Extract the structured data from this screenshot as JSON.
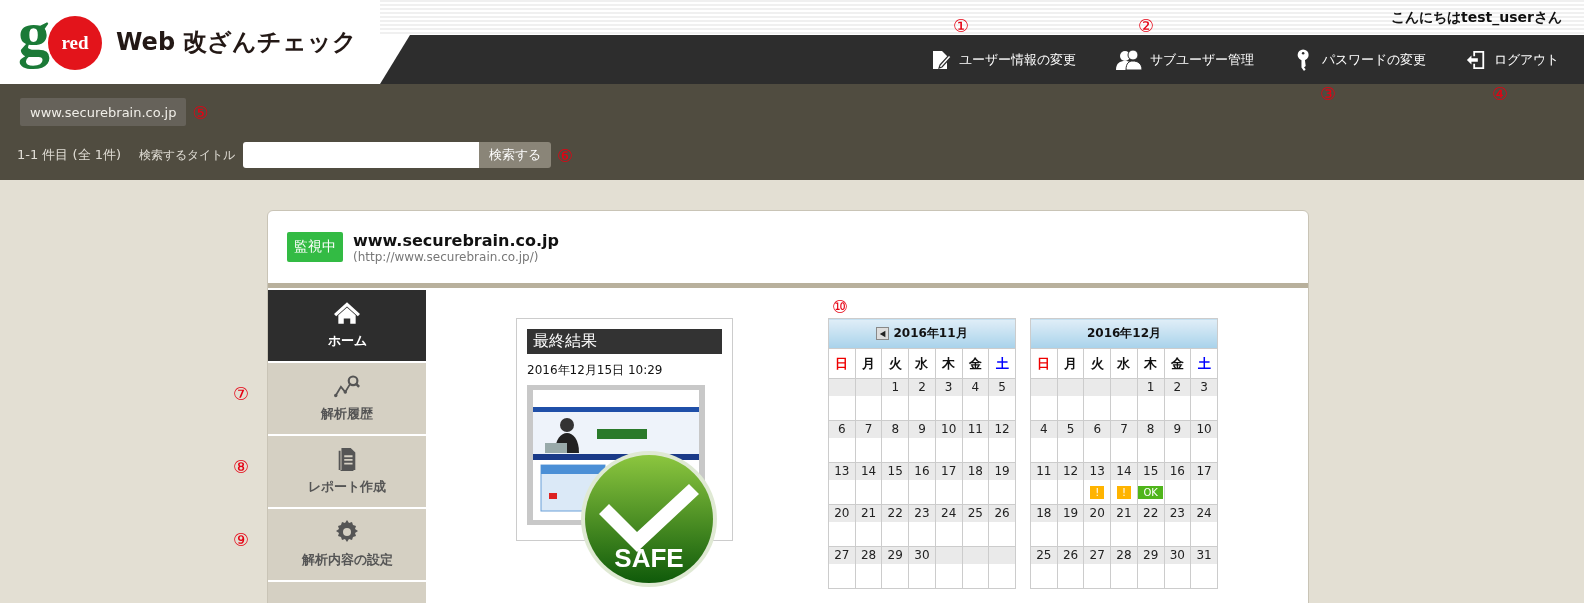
{
  "header": {
    "logo": {
      "letter": "g",
      "word": "red"
    },
    "title": "Web 改ざんチェック",
    "greeting": "こんにちはtest_userさん",
    "nav": [
      {
        "kind": "edit",
        "label": "ユーザー情報の変更",
        "annotation": "①"
      },
      {
        "kind": "users",
        "label": "サブユーザー管理",
        "annotation": "②"
      },
      {
        "kind": "key",
        "label": "パスワードの変更",
        "annotation": "③"
      },
      {
        "kind": "logout",
        "label": "ログアウト",
        "annotation": "④"
      }
    ]
  },
  "toolbar": {
    "site_tab": "www.securebrain.co.jp",
    "site_tab_annotation": "⑤",
    "count": "1-1 件目 (全 1件)",
    "search_label": "検索するタイトル",
    "search_button": "検索する",
    "search_annotation": "⑥"
  },
  "site": {
    "status": "監視中",
    "name": "www.securebrain.co.jp",
    "url": "(http://www.securebrain.co.jp/)"
  },
  "sidebar": {
    "items": [
      {
        "kind": "home",
        "label": "ホーム",
        "selected": true
      },
      {
        "kind": "history",
        "label": "解析履歴",
        "selected": false,
        "annotation": "⑦"
      },
      {
        "kind": "report",
        "label": "レポート作成",
        "selected": false,
        "annotation": "⑧"
      },
      {
        "kind": "settings",
        "label": "解析内容の設定",
        "selected": false,
        "annotation": "⑨"
      }
    ]
  },
  "result": {
    "title": "最終結果",
    "datetime": "2016年12月15日 10:29",
    "badge": "SAFE"
  },
  "calendar_annotation": "⑩",
  "calendars": [
    {
      "title": "2016年11月",
      "prev": true,
      "weekdays": [
        "日",
        "月",
        "火",
        "水",
        "木",
        "金",
        "土"
      ],
      "weeks": [
        [
          {
            "blank": true
          },
          {
            "blank": true
          },
          {
            "day": "1"
          },
          {
            "day": "2"
          },
          {
            "day": "3"
          },
          {
            "day": "4"
          },
          {
            "day": "5"
          }
        ],
        [
          {
            "day": "6"
          },
          {
            "day": "7"
          },
          {
            "day": "8"
          },
          {
            "day": "9"
          },
          {
            "day": "10"
          },
          {
            "day": "11"
          },
          {
            "day": "12"
          }
        ],
        [
          {
            "day": "13"
          },
          {
            "day": "14"
          },
          {
            "day": "15"
          },
          {
            "day": "16"
          },
          {
            "day": "17"
          },
          {
            "day": "18"
          },
          {
            "day": "19"
          }
        ],
        [
          {
            "day": "20"
          },
          {
            "day": "21"
          },
          {
            "day": "22"
          },
          {
            "day": "23"
          },
          {
            "day": "24"
          },
          {
            "day": "25"
          },
          {
            "day": "26"
          }
        ],
        [
          {
            "day": "27"
          },
          {
            "day": "28"
          },
          {
            "day": "29"
          },
          {
            "day": "30"
          },
          {
            "blank": true
          },
          {
            "blank": true
          },
          {
            "blank": true
          }
        ]
      ]
    },
    {
      "title": "2016年12月",
      "prev": false,
      "weekdays": [
        "日",
        "月",
        "火",
        "水",
        "木",
        "金",
        "土"
      ],
      "weeks": [
        [
          {
            "blank": true
          },
          {
            "blank": true
          },
          {
            "blank": true
          },
          {
            "blank": true
          },
          {
            "day": "1"
          },
          {
            "day": "2"
          },
          {
            "day": "3"
          }
        ],
        [
          {
            "day": "4"
          },
          {
            "day": "5"
          },
          {
            "day": "6"
          },
          {
            "day": "7"
          },
          {
            "day": "8"
          },
          {
            "day": "9"
          },
          {
            "day": "10"
          }
        ],
        [
          {
            "day": "11"
          },
          {
            "day": "12"
          },
          {
            "day": "13",
            "mark": {
              "kind": "warning",
              "text": "!"
            }
          },
          {
            "day": "14",
            "mark": {
              "kind": "warning",
              "text": "!"
            }
          },
          {
            "day": "15",
            "mark": {
              "kind": "ok",
              "text": "OK"
            }
          },
          {
            "day": "16"
          },
          {
            "day": "17"
          }
        ],
        [
          {
            "day": "18"
          },
          {
            "day": "19"
          },
          {
            "day": "20"
          },
          {
            "day": "21"
          },
          {
            "day": "22"
          },
          {
            "day": "23"
          },
          {
            "day": "24"
          }
        ],
        [
          {
            "day": "25"
          },
          {
            "day": "26"
          },
          {
            "day": "27"
          },
          {
            "day": "28"
          },
          {
            "day": "29"
          },
          {
            "day": "30"
          },
          {
            "day": "31"
          }
        ]
      ]
    }
  ]
}
